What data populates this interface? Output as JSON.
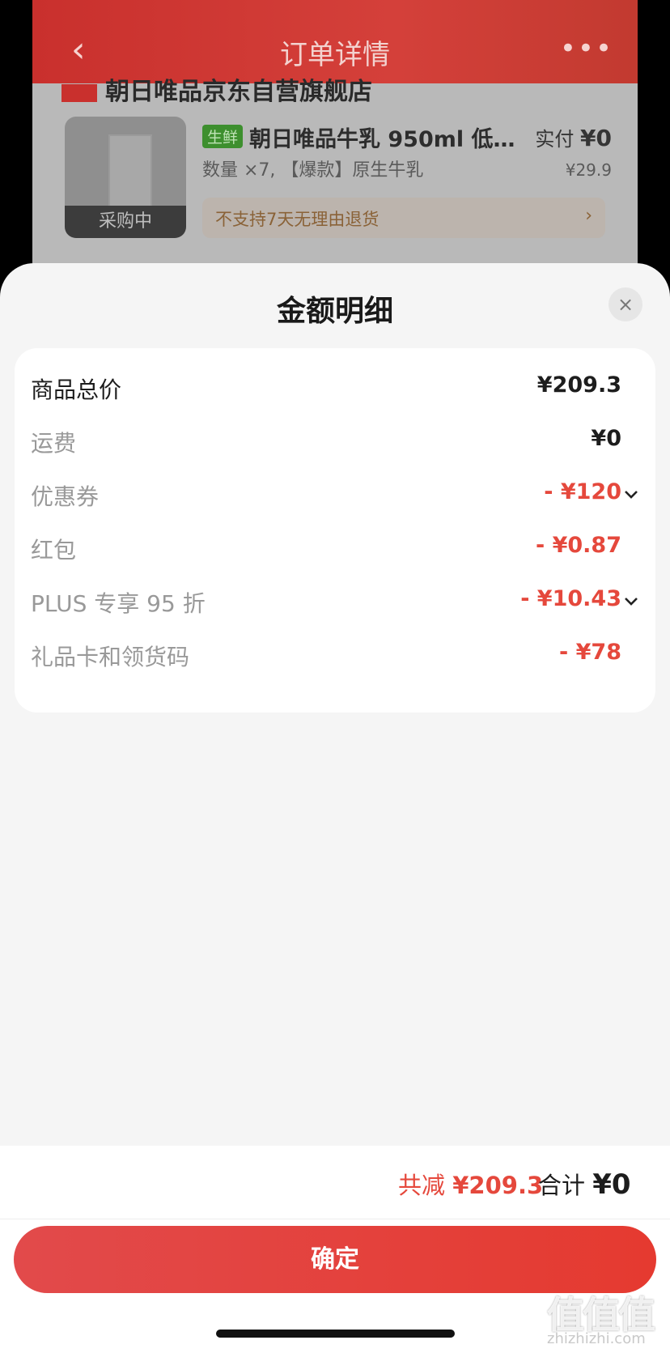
{
  "background": {
    "title": "订单详情",
    "back_icon": "‹",
    "more_icon": "•••",
    "store_name": "朝日唯品京东自营旗舰店",
    "product": {
      "tag": "生鲜",
      "name": "朝日唯品牛乳 950ml  低…",
      "paid_label": "实付",
      "paid_value": "¥0",
      "qty_text": "数量 ×7, 【爆款】原生牛乳",
      "unit_price": "¥29.9",
      "status": "采购中",
      "return_policy": "不支持7天无理由退货"
    }
  },
  "sheet": {
    "title": "金额明细",
    "close_icon": "×",
    "rows": [
      {
        "label": "商品总价",
        "value": "¥209.3"
      },
      {
        "label": "运费",
        "value": "¥0"
      },
      {
        "label": "优惠券",
        "value": "- ¥120"
      },
      {
        "label": "红包",
        "value": "- ¥0.87"
      },
      {
        "label": "PLUS 专享 95 折",
        "value": "- ¥10.43"
      },
      {
        "label": "礼品卡和领货码",
        "value": "- ¥78"
      }
    ],
    "total_reduce_label": "共减",
    "total_reduce_value": "¥209.3",
    "total_label": "合计",
    "total_value": "¥0",
    "confirm_label": "确定"
  },
  "watermark": {
    "text": "值值值",
    "sub": "zhizhizhi.com"
  },
  "colors": {
    "accent_red": "#e5483c",
    "header_red": "#c9302d",
    "sheet_bg": "#f5f5f5"
  }
}
